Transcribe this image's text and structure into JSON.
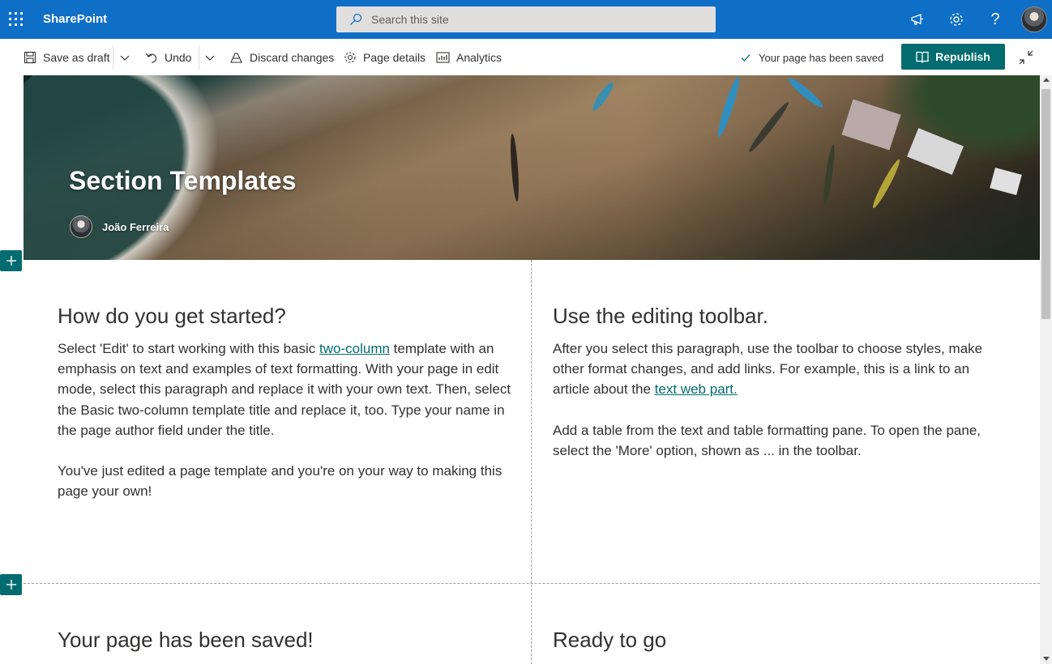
{
  "suite": {
    "brand": "SharePoint",
    "search_placeholder": "Search this site",
    "icons": [
      "waffle-icon",
      "megaphone-icon",
      "gear-icon",
      "help-icon"
    ]
  },
  "commands": {
    "save_as_draft": "Save as draft",
    "undo": "Undo",
    "discard_changes": "Discard changes",
    "page_details": "Page details",
    "analytics": "Analytics",
    "saved_status": "Your page has been saved",
    "republish": "Republish"
  },
  "hero": {
    "title": "Section Templates",
    "author": "João Ferreira"
  },
  "sections": {
    "left1": {
      "heading": "How do you get started?",
      "p1_before": "Select 'Edit' to start working with this basic ",
      "p1_link": "two-column",
      "p1_after": " template with an emphasis on text and examples of text formatting. With your page in edit mode, select this paragraph and replace it with your own text. Then, select the Basic two-column template title and replace it, too. Type your name in the page author field under the title.",
      "p2": "You've just edited a page template and you're on your way to making this page your own!"
    },
    "right1": {
      "heading": "Use the editing toolbar.",
      "p1_before": "After you select this paragraph, use the toolbar to choose styles, make other format changes, and add links. For example, this is a link to an article about the ",
      "p1_link": "text web part.",
      "p2": "Add a table from the text and table formatting pane. To open the pane, select the 'More' option, shown as ... in the toolbar."
    },
    "left2": {
      "heading": "Your page has been saved!"
    },
    "right2": {
      "heading": "Ready to go"
    }
  },
  "colors": {
    "suite_bar": "#0f6fc6",
    "accent": "#036c70",
    "search_bg": "#e1dfdd"
  }
}
